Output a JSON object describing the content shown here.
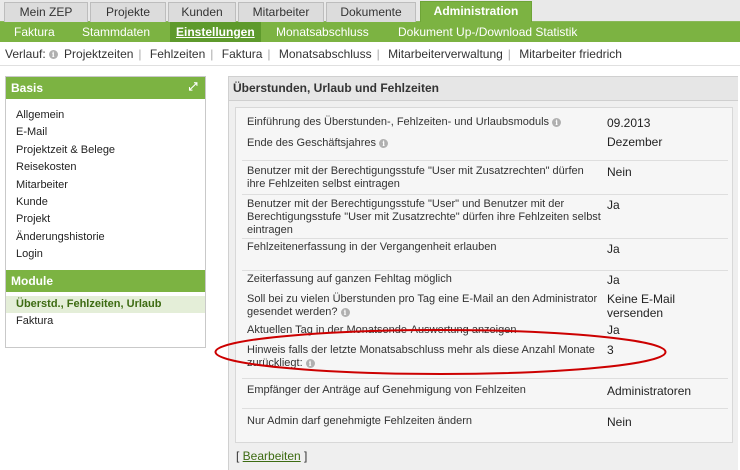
{
  "top_tabs": [
    "Mein ZEP",
    "Projekte",
    "Kunden",
    "Mitarbeiter",
    "Dokumente",
    "Administration"
  ],
  "menu": [
    "Faktura",
    "Stammdaten",
    "Einstellungen",
    "Monatsabschluss",
    "Dokument Up-/Download Statistik"
  ],
  "verlauf": {
    "label": "Verlauf:",
    "items": [
      "Projektzeiten",
      "Fehlzeiten",
      "Faktura",
      "Monatsabschluss",
      "Mitarbeiterverwaltung",
      "Mitarbeiter friedrich"
    ]
  },
  "sidebar": {
    "basis_title": "Basis",
    "basis_items": [
      "Allgemein",
      "E-Mail",
      "Projektzeit & Belege",
      "Reisekosten",
      "Mitarbeiter",
      "Kunde",
      "Projekt",
      "Änderungshistorie",
      "Login"
    ],
    "module_title": "Module",
    "module_items": [
      "Überstd., Fehlzeiten, Urlaub",
      "Faktura"
    ]
  },
  "panel": {
    "title": "Überstunden, Urlaub und Fehlzeiten",
    "rows": [
      {
        "label": "Einführung des Überstunden-, Fehlzeiten- und Urlaubsmoduls",
        "value": "09.2013"
      },
      {
        "label": "Ende des Geschäftsjahres",
        "value": "Dezember"
      },
      {
        "label": "Benutzer mit der Berechtigungsstufe \"User mit Zusatzrechten\" dürfen ihre Fehlzeiten selbst eintragen",
        "value": "Nein"
      },
      {
        "label": "Benutzer mit der Berechtigungsstufe \"User\" und Benutzer mit der Berechtigungsstufe \"User mit Zusatzrechte\" dürfen ihre Fehlzeiten selbst eintragen",
        "value": "Ja"
      },
      {
        "label": "Fehlzeitenerfassung in der Vergangenheit erlauben",
        "value": "Ja"
      },
      {
        "label": "Zeiterfassung auf ganzen Fehltag möglich",
        "value": "Ja"
      },
      {
        "label": "Soll bei zu vielen Überstunden pro Tag eine E-Mail an den Administrator gesendet werden?",
        "value": "Keine E-Mail versenden"
      },
      {
        "label": "Aktuellen Tag in der Monatsende-Auswertung anzeigen",
        "value": "Ja"
      },
      {
        "label": "Hinweis falls der letzte Monatsabschluss mehr als diese Anzahl Monate zurückliegt:",
        "value": "3"
      },
      {
        "label": "Empfänger der Anträge auf Genehmigung von Fehlzeiten",
        "value": "Administratoren"
      },
      {
        "label": "Nur Admin darf genehmigte Fehlzeiten ändern",
        "value": "Nein"
      }
    ],
    "edit_label": "Bearbeiten"
  },
  "colors": {
    "accent": "#7cb342",
    "accent_dark": "#5e9a2c",
    "highlight": "#cc0000"
  }
}
